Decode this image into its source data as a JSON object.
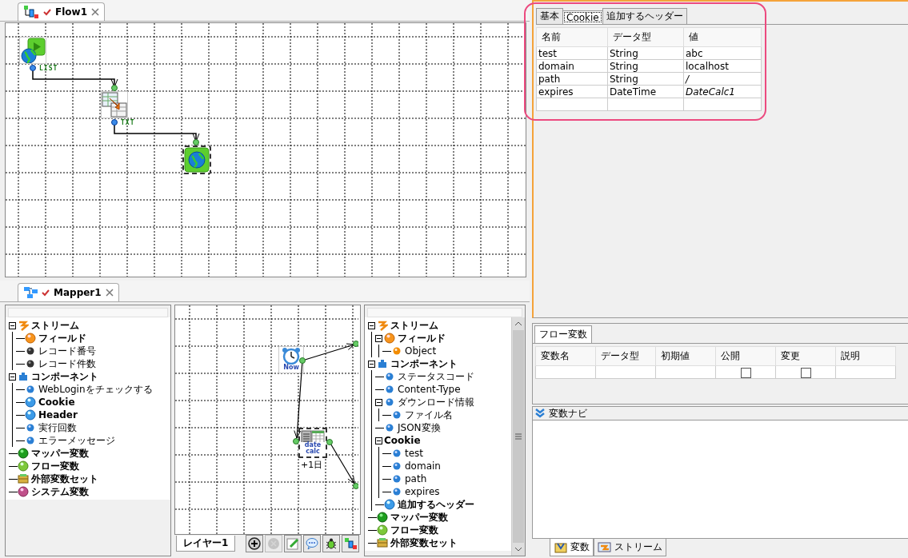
{
  "flow_tab": {
    "title": "Flow1"
  },
  "flow_canvas": {
    "nodes": [
      {
        "kind": "start",
        "selected": false
      },
      {
        "kind": "mapper",
        "selected": false
      },
      {
        "kind": "web",
        "selected": true
      }
    ],
    "links": [
      {
        "label": "LIST"
      },
      {
        "label": "TXT"
      }
    ]
  },
  "mapper_tab": {
    "title": "Mapper1"
  },
  "source_tree": [
    {
      "label": "ストリーム",
      "kind": "stream",
      "expanded": true,
      "children": [
        {
          "label": "フィールド",
          "kind": "field"
        },
        {
          "label": "レコード番号",
          "kind": "record"
        },
        {
          "label": "レコード件数",
          "kind": "record"
        }
      ]
    },
    {
      "label": "コンポーネント",
      "kind": "component",
      "expanded": true,
      "children": [
        {
          "label": "WebLoginをチェックする",
          "kind": "value"
        },
        {
          "label": "Cookie",
          "kind": "param"
        },
        {
          "label": "Header",
          "kind": "param"
        },
        {
          "label": "実行回数",
          "kind": "value"
        },
        {
          "label": "エラーメッセージ",
          "kind": "value"
        }
      ]
    },
    {
      "label": "マッパー変数",
      "kind": "mapper-var"
    },
    {
      "label": "フロー変数",
      "kind": "flow-var"
    },
    {
      "label": "外部変数セット",
      "kind": "ext-var"
    },
    {
      "label": "システム変数",
      "kind": "sys-var"
    }
  ],
  "mapper_canvas": {
    "nodes": [
      {
        "kind": "now",
        "icon_text": "Now",
        "selected": false
      },
      {
        "kind": "datecalc",
        "icon_text": "date calc",
        "caption": "+1日",
        "selected": true
      }
    ]
  },
  "layer_tabs": [
    {
      "label": "レイヤー1",
      "selected": true
    }
  ],
  "toolbar": [
    {
      "kind": "add",
      "disabled": false
    },
    {
      "kind": "remove",
      "disabled": true
    },
    {
      "kind": "edit",
      "disabled": false
    },
    {
      "kind": "comment",
      "disabled": false
    },
    {
      "kind": "debug",
      "disabled": false
    },
    {
      "kind": "layout",
      "disabled": false
    }
  ],
  "target_tree": [
    {
      "label": "ストリーム",
      "kind": "stream",
      "expanded": true,
      "children": [
        {
          "label": "フィールド",
          "kind": "field",
          "expanded": true,
          "children": [
            {
              "label": "Object",
              "kind": "object"
            }
          ]
        }
      ]
    },
    {
      "label": "コンポーネント",
      "kind": "component",
      "expanded": true,
      "children": [
        {
          "label": "ステータスコード",
          "kind": "value"
        },
        {
          "label": "Content-Type",
          "kind": "value"
        },
        {
          "label": "ダウンロード情報",
          "kind": "value",
          "expanded": true,
          "children": [
            {
              "label": "ファイル名",
              "kind": "value"
            }
          ]
        },
        {
          "label": "JSON変換",
          "kind": "value"
        },
        {
          "label": "Cookie",
          "kind": "group",
          "expanded": true,
          "children": [
            {
              "label": "test",
              "kind": "value"
            },
            {
              "label": "domain",
              "kind": "value"
            },
            {
              "label": "path",
              "kind": "value"
            },
            {
              "label": "expires",
              "kind": "value"
            }
          ]
        },
        {
          "label": "追加するヘッダー",
          "kind": "param"
        }
      ]
    },
    {
      "label": "マッパー変数",
      "kind": "mapper-var"
    },
    {
      "label": "フロー変数",
      "kind": "flow-var"
    },
    {
      "label": "外部変数セット",
      "kind": "ext-var"
    }
  ],
  "property_tabs": [
    {
      "label": "基本",
      "selected": false
    },
    {
      "label": "Cookie",
      "selected": true
    },
    {
      "label": "追加するヘッダー",
      "selected": false
    }
  ],
  "cookie_table": {
    "columns": [
      "名前",
      "データ型",
      "値"
    ],
    "rows": [
      {
        "cells": [
          "test",
          "String",
          "abc"
        ],
        "mapped": false
      },
      {
        "cells": [
          "domain",
          "String",
          "localhost"
        ],
        "mapped": false
      },
      {
        "cells": [
          "path",
          "String",
          "/"
        ],
        "mapped": true
      },
      {
        "cells": [
          "expires",
          "DateTime",
          "DateCalc1"
        ],
        "mapped": true
      }
    ]
  },
  "flow_variables": {
    "tab": "フロー変数",
    "columns": [
      "変数名",
      "データ型",
      "初期値",
      "公開",
      "変更",
      "説明"
    ],
    "rows": [
      {
        "public": false,
        "changeable": false
      }
    ]
  },
  "variable_navi": {
    "title": "変数ナビ"
  },
  "bottom_tabs": [
    {
      "label": "変数",
      "kind": "variables",
      "selected": true
    },
    {
      "label": "ストリーム",
      "kind": "stream",
      "selected": false
    }
  ]
}
